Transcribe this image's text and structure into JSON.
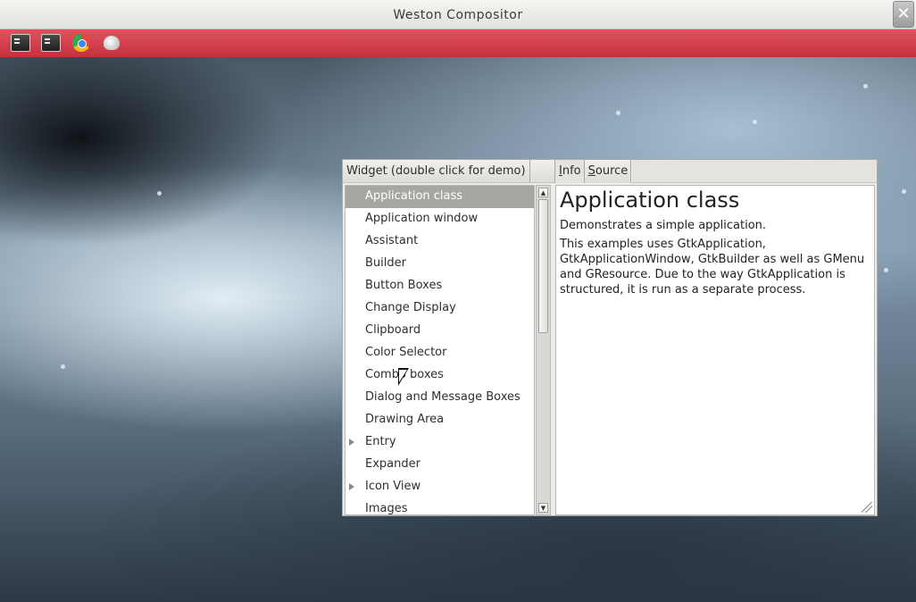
{
  "window": {
    "title": "Weston Compositor",
    "close_glyph": "✕"
  },
  "panel": {
    "color": "#d03a47",
    "launchers": [
      {
        "name": "terminal-icon"
      },
      {
        "name": "terminal-icon"
      },
      {
        "name": "chrome-icon"
      },
      {
        "name": "flower-icon"
      }
    ]
  },
  "demo": {
    "column_header": "Widget (double click for demo)",
    "tabs": [
      {
        "label": "Info",
        "mnemonic": "I"
      },
      {
        "label": "Source",
        "mnemonic": "S"
      }
    ],
    "items": [
      {
        "label": "Application class",
        "selected": true,
        "expandable": false
      },
      {
        "label": "Application window",
        "selected": false,
        "expandable": false
      },
      {
        "label": "Assistant",
        "selected": false,
        "expandable": false
      },
      {
        "label": "Builder",
        "selected": false,
        "expandable": false
      },
      {
        "label": "Button Boxes",
        "selected": false,
        "expandable": false
      },
      {
        "label": "Change Display",
        "selected": false,
        "expandable": false
      },
      {
        "label": "Clipboard",
        "selected": false,
        "expandable": false
      },
      {
        "label": "Color Selector",
        "selected": false,
        "expandable": false
      },
      {
        "label": "Combo boxes",
        "selected": false,
        "expandable": false
      },
      {
        "label": "Dialog and Message Boxes",
        "selected": false,
        "expandable": false
      },
      {
        "label": "Drawing Area",
        "selected": false,
        "expandable": false
      },
      {
        "label": "Entry",
        "selected": false,
        "expandable": true
      },
      {
        "label": "Expander",
        "selected": false,
        "expandable": false
      },
      {
        "label": "Icon View",
        "selected": false,
        "expandable": true
      },
      {
        "label": "Images",
        "selected": false,
        "expandable": false
      }
    ],
    "info": {
      "heading": "Application class",
      "summary": "Demonstrates a simple application.",
      "body": "This examples uses GtkApplication, GtkApplicationWindow, GtkBuilder as well as GMenu and GResource. Due to the way GtkApplication is structured, it is run as a separate process."
    }
  }
}
